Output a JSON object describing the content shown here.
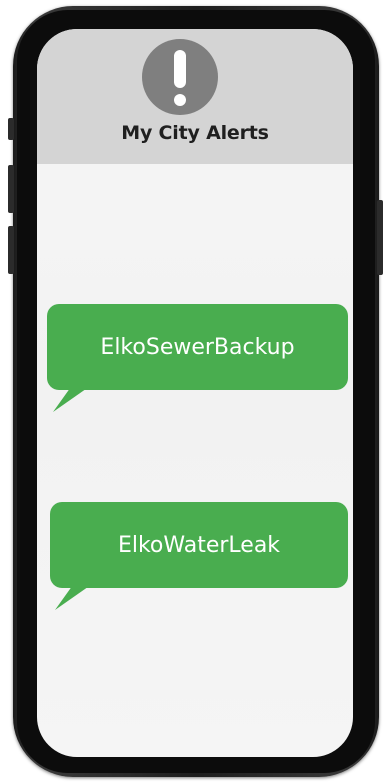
{
  "header": {
    "title": "My City Alerts",
    "icon": "exclamation-alert-icon"
  },
  "alerts": [
    {
      "label": "ElkoSewerBackup"
    },
    {
      "label": "ElkoWaterLeak"
    }
  ],
  "colors": {
    "bubble": "#49ad4f",
    "header_bg": "#d4d4d4",
    "icon_circle": "#7f7f7f",
    "phone_frame": "#1e1e1e"
  }
}
